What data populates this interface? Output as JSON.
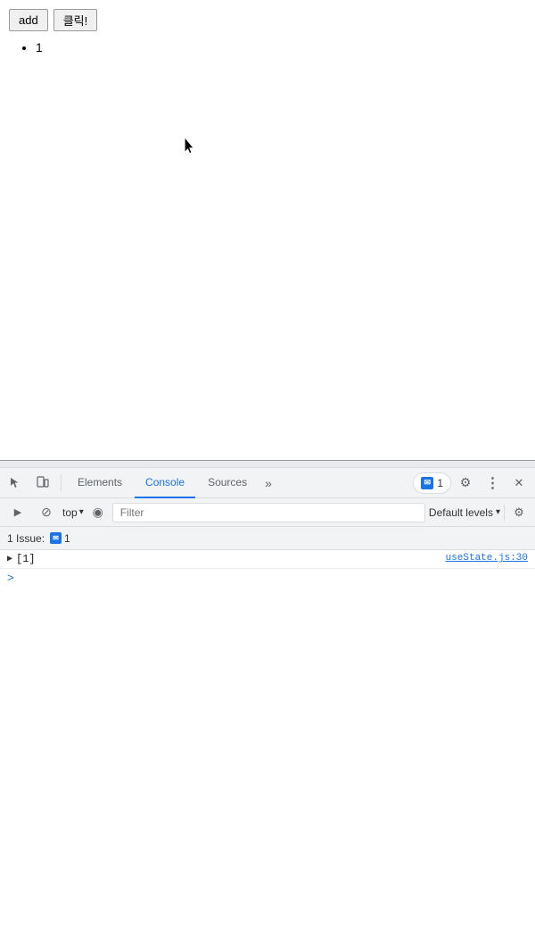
{
  "page": {
    "buttons": [
      {
        "label": "add",
        "id": "add-btn"
      },
      {
        "label": "클릭!",
        "id": "click-btn"
      }
    ],
    "list_item": "1"
  },
  "devtools": {
    "tabs": [
      {
        "label": "Elements",
        "active": false
      },
      {
        "label": "Console",
        "active": true
      },
      {
        "label": "Sources",
        "active": false
      }
    ],
    "more_tabs_label": "»",
    "badge_count": "1",
    "toolbar": {
      "context_selector": "top",
      "filter_placeholder": "Filter",
      "levels_label": "Default levels"
    },
    "issue_bar": {
      "prefix": "1 Issue:",
      "count": "1"
    },
    "console_entries": [
      {
        "id": "entry-1",
        "collapsed": true,
        "value": "[1]",
        "source_link": "useState.js:30"
      }
    ],
    "prompt_symbol": ">",
    "icons": {
      "inspect": "⬚",
      "device": "⬜",
      "gear": "⚙",
      "dots": "⋮",
      "close": "✕",
      "play": "▶",
      "stop": "⊘",
      "eye": "◉",
      "chevron_down": "▾",
      "settings2": "⚙"
    }
  }
}
